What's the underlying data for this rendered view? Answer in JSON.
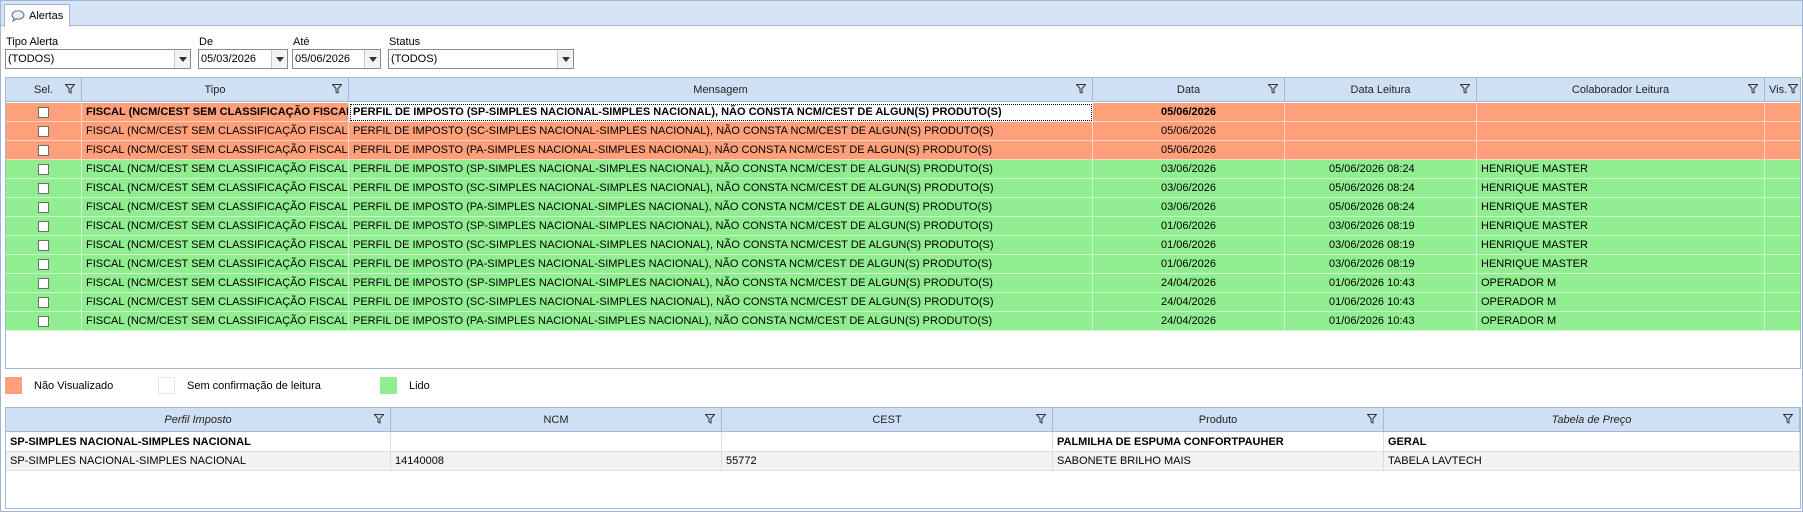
{
  "tab": {
    "label": "Alertas",
    "icon": "speech-bubble-icon"
  },
  "filters": {
    "tipo_alerta": {
      "label": "Tipo Alerta",
      "value": "(TODOS)"
    },
    "de": {
      "label": "De",
      "value": "05/03/2026"
    },
    "ate": {
      "label": "Até",
      "value": "05/06/2026"
    },
    "status": {
      "label": "Status",
      "value": "(TODOS)"
    }
  },
  "colors": {
    "nao_visualizado": "#ffa07a",
    "lido": "#90ee90",
    "sem_confirmacao": "#ffffff",
    "header": "#cfe0f5"
  },
  "alerts": {
    "columns": [
      "Sel.",
      "Tipo",
      "Mensagem",
      "Data",
      "Data Leitura",
      "Colaborador Leitura",
      "Vis."
    ],
    "rows": [
      {
        "status": "nao_visualizado",
        "tipo": "FISCAL (NCM/CEST SEM CLASSIFICAÇÃO FISCAL)",
        "mensagem": "PERFIL DE IMPOSTO (SP-SIMPLES NACIONAL-SIMPLES NACIONAL), NÃO CONSTA NCM/CEST DE ALGUN(S) PRODUTO(S)",
        "data": "05/06/2026",
        "data_leitura": "",
        "colaborador": ""
      },
      {
        "status": "nao_visualizado",
        "tipo": "FISCAL (NCM/CEST SEM CLASSIFICAÇÃO FISCAL)",
        "mensagem": "PERFIL DE IMPOSTO (SC-SIMPLES NACIONAL-SIMPLES NACIONAL), NÃO CONSTA NCM/CEST DE ALGUN(S) PRODUTO(S)",
        "data": "05/06/2026",
        "data_leitura": "",
        "colaborador": ""
      },
      {
        "status": "nao_visualizado",
        "tipo": "FISCAL (NCM/CEST SEM CLASSIFICAÇÃO FISCAL)",
        "mensagem": "PERFIL DE IMPOSTO (PA-SIMPLES NACIONAL-SIMPLES NACIONAL), NÃO CONSTA NCM/CEST DE ALGUN(S) PRODUTO(S)",
        "data": "05/06/2026",
        "data_leitura": "",
        "colaborador": ""
      },
      {
        "status": "lido",
        "tipo": "FISCAL (NCM/CEST SEM CLASSIFICAÇÃO FISCAL)",
        "mensagem": "PERFIL DE IMPOSTO (SP-SIMPLES NACIONAL-SIMPLES NACIONAL), NÃO CONSTA NCM/CEST DE ALGUN(S) PRODUTO(S)",
        "data": "03/06/2026",
        "data_leitura": "05/06/2026 08:24",
        "colaborador": "HENRIQUE MASTER"
      },
      {
        "status": "lido",
        "tipo": "FISCAL (NCM/CEST SEM CLASSIFICAÇÃO FISCAL)",
        "mensagem": "PERFIL DE IMPOSTO (SC-SIMPLES NACIONAL-SIMPLES NACIONAL), NÃO CONSTA NCM/CEST DE ALGUN(S) PRODUTO(S)",
        "data": "03/06/2026",
        "data_leitura": "05/06/2026 08:24",
        "colaborador": "HENRIQUE MASTER"
      },
      {
        "status": "lido",
        "tipo": "FISCAL (NCM/CEST SEM CLASSIFICAÇÃO FISCAL)",
        "mensagem": "PERFIL DE IMPOSTO (PA-SIMPLES NACIONAL-SIMPLES NACIONAL), NÃO CONSTA NCM/CEST DE ALGUN(S) PRODUTO(S)",
        "data": "03/06/2026",
        "data_leitura": "05/06/2026 08:24",
        "colaborador": "HENRIQUE MASTER"
      },
      {
        "status": "lido",
        "tipo": "FISCAL (NCM/CEST SEM CLASSIFICAÇÃO FISCAL)",
        "mensagem": "PERFIL DE IMPOSTO (SP-SIMPLES NACIONAL-SIMPLES NACIONAL), NÃO CONSTA NCM/CEST DE ALGUN(S) PRODUTO(S)",
        "data": "01/06/2026",
        "data_leitura": "03/06/2026 08:19",
        "colaborador": "HENRIQUE MASTER"
      },
      {
        "status": "lido",
        "tipo": "FISCAL (NCM/CEST SEM CLASSIFICAÇÃO FISCAL)",
        "mensagem": "PERFIL DE IMPOSTO (SC-SIMPLES NACIONAL-SIMPLES NACIONAL), NÃO CONSTA NCM/CEST DE ALGUN(S) PRODUTO(S)",
        "data": "01/06/2026",
        "data_leitura": "03/06/2026 08:19",
        "colaborador": "HENRIQUE MASTER"
      },
      {
        "status": "lido",
        "tipo": "FISCAL (NCM/CEST SEM CLASSIFICAÇÃO FISCAL)",
        "mensagem": "PERFIL DE IMPOSTO (PA-SIMPLES NACIONAL-SIMPLES NACIONAL), NÃO CONSTA NCM/CEST DE ALGUN(S) PRODUTO(S)",
        "data": "01/06/2026",
        "data_leitura": "03/06/2026 08:19",
        "colaborador": "HENRIQUE MASTER"
      },
      {
        "status": "lido",
        "tipo": "FISCAL (NCM/CEST SEM CLASSIFICAÇÃO FISCAL)",
        "mensagem": "PERFIL DE IMPOSTO (SP-SIMPLES NACIONAL-SIMPLES NACIONAL), NÃO CONSTA NCM/CEST DE ALGUN(S) PRODUTO(S)",
        "data": "24/04/2026",
        "data_leitura": "01/06/2026 10:43",
        "colaborador": "OPERADOR M"
      },
      {
        "status": "lido",
        "tipo": "FISCAL (NCM/CEST SEM CLASSIFICAÇÃO FISCAL)",
        "mensagem": "PERFIL DE IMPOSTO (SC-SIMPLES NACIONAL-SIMPLES NACIONAL), NÃO CONSTA NCM/CEST DE ALGUN(S) PRODUTO(S)",
        "data": "24/04/2026",
        "data_leitura": "01/06/2026 10:43",
        "colaborador": "OPERADOR M"
      },
      {
        "status": "lido",
        "tipo": "FISCAL (NCM/CEST SEM CLASSIFICAÇÃO FISCAL)",
        "mensagem": "PERFIL DE IMPOSTO (PA-SIMPLES NACIONAL-SIMPLES NACIONAL), NÃO CONSTA NCM/CEST DE ALGUN(S) PRODUTO(S)",
        "data": "24/04/2026",
        "data_leitura": "01/06/2026 10:43",
        "colaborador": "OPERADOR M"
      }
    ]
  },
  "legend": {
    "nao_visualizado": "Não Visualizado",
    "sem_confirmacao": "Sem confirmação de leitura",
    "lido": "Lido"
  },
  "details": {
    "columns": [
      "Perfil Imposto",
      "NCM",
      "CEST",
      "Produto",
      "Tabela de Preço"
    ],
    "rows": [
      {
        "perfil": "SP-SIMPLES NACIONAL-SIMPLES NACIONAL",
        "ncm": "",
        "cest": "",
        "produto": "PALMILHA DE ESPUMA CONFORTPAUHER",
        "tabela": "GERAL",
        "bold": true
      },
      {
        "perfil": "SP-SIMPLES NACIONAL-SIMPLES NACIONAL",
        "ncm": "14140008",
        "cest": "55772",
        "produto": "SABONETE BRILHO MAIS",
        "tabela": "TABELA LAVTECH",
        "bold": false
      }
    ]
  }
}
